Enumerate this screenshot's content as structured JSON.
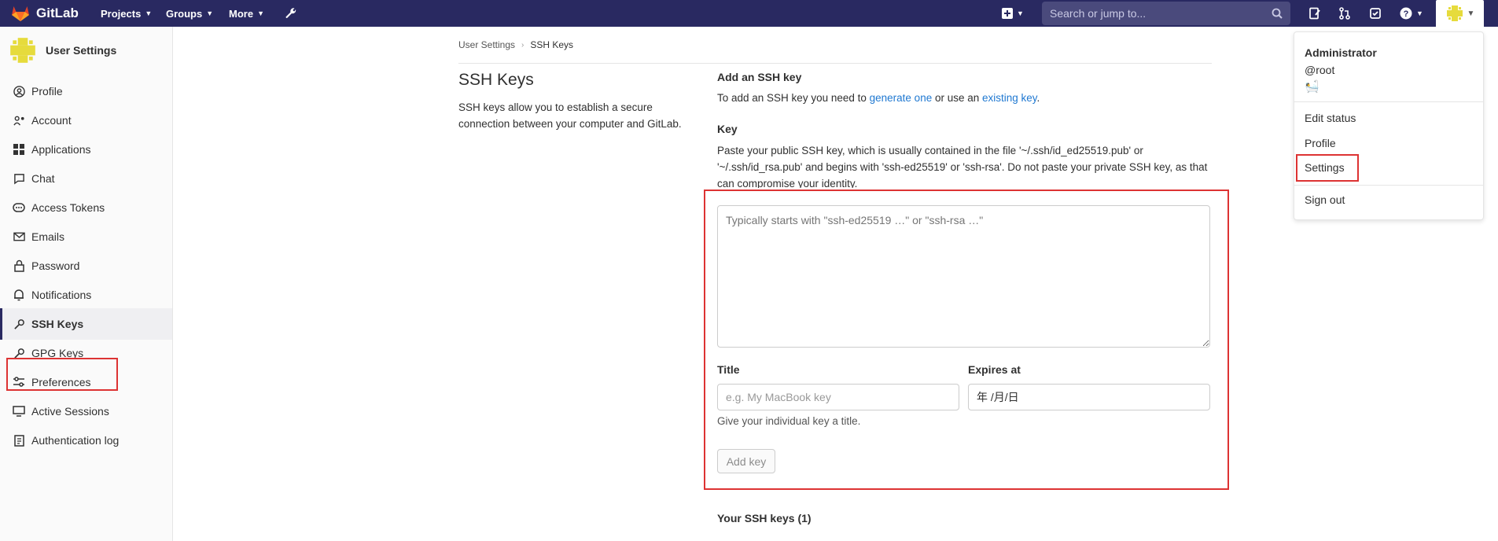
{
  "topbar": {
    "brand": "GitLab",
    "nav": [
      {
        "label": "Projects"
      },
      {
        "label": "Groups"
      },
      {
        "label": "More"
      }
    ],
    "search_placeholder": "Search or jump to...",
    "bg_color": "#292961"
  },
  "sidebar": {
    "title": "User Settings",
    "items": [
      {
        "label": "Profile",
        "icon": "profile-icon"
      },
      {
        "label": "Account",
        "icon": "account-icon"
      },
      {
        "label": "Applications",
        "icon": "applications-icon"
      },
      {
        "label": "Chat",
        "icon": "chat-icon"
      },
      {
        "label": "Access Tokens",
        "icon": "token-icon"
      },
      {
        "label": "Emails",
        "icon": "mail-icon"
      },
      {
        "label": "Password",
        "icon": "lock-icon"
      },
      {
        "label": "Notifications",
        "icon": "bell-icon"
      },
      {
        "label": "SSH Keys",
        "icon": "key-icon",
        "active": true
      },
      {
        "label": "GPG Keys",
        "icon": "key-icon"
      },
      {
        "label": "Preferences",
        "icon": "preferences-icon"
      },
      {
        "label": "Active Sessions",
        "icon": "monitor-icon"
      },
      {
        "label": "Authentication log",
        "icon": "log-icon"
      }
    ]
  },
  "breadcrumb": {
    "parent": "User Settings",
    "current": "SSH Keys"
  },
  "main": {
    "heading": "SSH Keys",
    "description": "SSH keys allow you to establish a secure connection between your computer and GitLab.",
    "add_heading": "Add an SSH key",
    "add_text_pre": "To add an SSH key you need to ",
    "add_link1": "generate one",
    "add_text_mid": " or use an ",
    "add_link2": "existing key",
    "add_text_post": ".",
    "key_label": "Key",
    "key_help": "Paste your public SSH key, which is usually contained in the file '~/.ssh/id_ed25519.pub' or '~/.ssh/id_rsa.pub' and begins with 'ssh-ed25519' or 'ssh-rsa'. Do not paste your private SSH key, as that can compromise your identity.",
    "key_placeholder": "Typically starts with \"ssh-ed25519 …\" or \"ssh-rsa …\"",
    "title_label": "Title",
    "title_placeholder": "e.g. My MacBook key",
    "expires_label": "Expires at",
    "expires_placeholder": "年 /月/日",
    "title_help": "Give your individual key a title.",
    "add_button": "Add key",
    "your_keys": "Your SSH keys (1)"
  },
  "user_menu": {
    "name": "Administrator",
    "username": "@root",
    "status_emoji": "🛀",
    "items": [
      "Edit status",
      "Profile",
      "Settings",
      "Sign out"
    ]
  },
  "colors": {
    "highlight": "#dd3333",
    "link": "#1f78d1"
  }
}
